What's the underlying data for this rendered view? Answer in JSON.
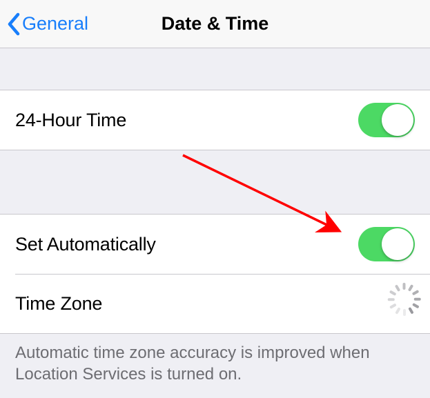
{
  "navbar": {
    "back_label": "General",
    "title": "Date & Time"
  },
  "rows": {
    "twentyFourHour": {
      "label": "24-Hour Time",
      "on": true
    },
    "setAutomatically": {
      "label": "Set Automatically",
      "on": true
    },
    "timeZone": {
      "label": "Time Zone",
      "loading": true
    }
  },
  "footer": {
    "text": "Automatic time zone accuracy is improved when Location Services is turned on."
  },
  "annotation": {
    "arrow_color": "#ff0000"
  }
}
